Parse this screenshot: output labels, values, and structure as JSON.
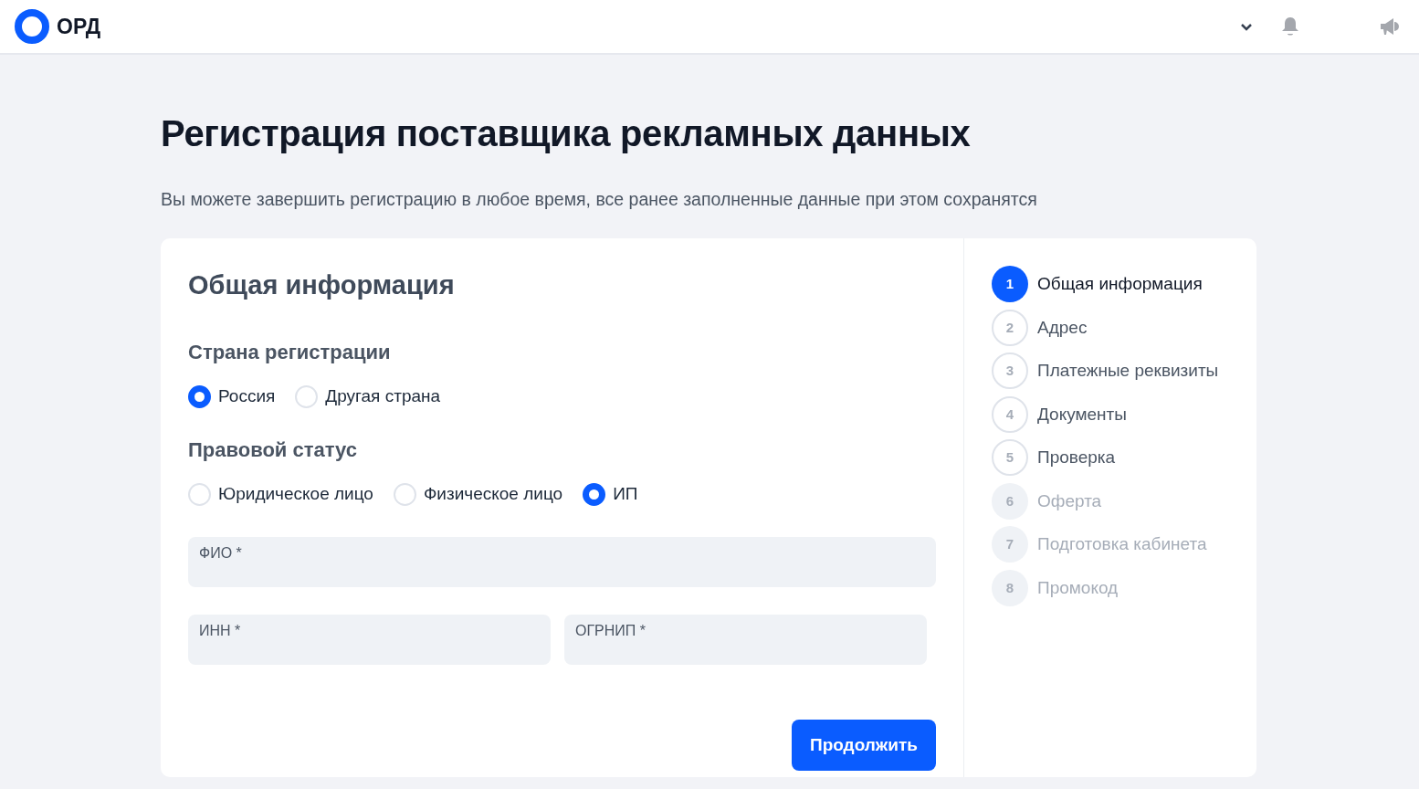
{
  "header": {
    "logo_text": "ОРД"
  },
  "title": "Регистрация поставщика рекламных данных",
  "subtitle": "Вы можете завершить регистрацию в любое время, все ранее заполненные данные при этом сохранятся",
  "form": {
    "heading": "Общая информация",
    "groups": [
      {
        "label": "Страна регистрации",
        "options": [
          {
            "label": "Россия",
            "selected": true
          },
          {
            "label": "Другая страна",
            "selected": false
          }
        ]
      },
      {
        "label": "Правовой статус",
        "options": [
          {
            "label": "Юридическое лицо",
            "selected": false
          },
          {
            "label": "Физическое лицо",
            "selected": false
          },
          {
            "label": "ИП",
            "selected": true
          }
        ]
      }
    ],
    "fields": [
      [
        {
          "label": "ФИО *"
        }
      ],
      [
        {
          "label": "ИНН *"
        },
        {
          "label": "ОГРНИП *"
        }
      ]
    ],
    "submit": "Продолжить"
  },
  "steps": [
    {
      "number": "1",
      "label": "Общая информация",
      "selected": true,
      "disabled": false
    },
    {
      "number": "2",
      "label": "Адрес",
      "selected": false,
      "disabled": false
    },
    {
      "number": "3",
      "label": "Платежные реквизиты",
      "selected": false,
      "disabled": false
    },
    {
      "number": "4",
      "label": "Документы",
      "selected": false,
      "disabled": false
    },
    {
      "number": "5",
      "label": "Проверка",
      "selected": false,
      "disabled": false
    },
    {
      "number": "6",
      "label": "Оферта",
      "selected": false,
      "disabled": true
    },
    {
      "number": "7",
      "label": "Подготовка кабинета",
      "selected": false,
      "disabled": true
    },
    {
      "number": "8",
      "label": "Промокод",
      "selected": false,
      "disabled": true
    }
  ]
}
